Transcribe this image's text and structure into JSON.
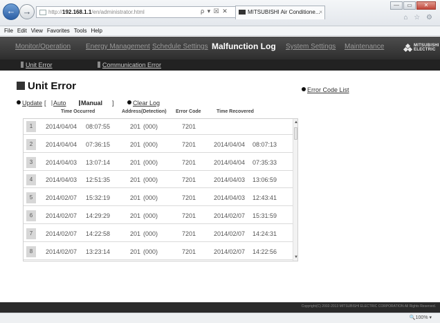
{
  "browser": {
    "address_prefix": "http://",
    "address_host": "192.168.1.1",
    "address_path": "/en/administrator.html",
    "address_tools": "ρ ▾ ☒ ✕",
    "tab_title": "MITSUBISHI Air Conditione...",
    "tab_close": "×",
    "back_glyph": "←",
    "forward_glyph": "→",
    "window_minimize": "—",
    "window_restore": "▭",
    "window_close": "✕",
    "toolbar_icons": "⌂ ☆ ⚙",
    "menu": [
      "File",
      "Edit",
      "View",
      "Favorites",
      "Tools",
      "Help"
    ],
    "zoom": "🔍100%  ▾"
  },
  "nav": {
    "items": [
      "Monitor/Operation",
      "Energy Management",
      "Schedule Settings",
      "Malfunction Log",
      "System Settings",
      "Maintenance"
    ],
    "active": "Malfunction Log",
    "logo_line1": "MITSUBISHI",
    "logo_line2": "ELECTRIC"
  },
  "subnav": {
    "items": [
      "Unit Error",
      "Communication Error"
    ]
  },
  "page": {
    "title": "Unit Error",
    "error_code_list": "Error Code List",
    "update": "Update",
    "bracket_open": "[",
    "auto": "Auto",
    "manual": "Manual",
    "bracket_close": "]",
    "clear_log": "Clear Log"
  },
  "table": {
    "headers": [
      "Time Occurred",
      "Address(Detection)",
      "Error Code",
      "Time Recovered"
    ],
    "rows": [
      {
        "num": "1",
        "date": "2014/04/04",
        "time": "08:07:55",
        "address": "201",
        "detection": "(000)",
        "code": "7201",
        "rec_date": "",
        "rec_time": ""
      },
      {
        "num": "2",
        "date": "2014/04/04",
        "time": "07:36:15",
        "address": "201",
        "detection": "(000)",
        "code": "7201",
        "rec_date": "2014/04/04",
        "rec_time": "08:07:13"
      },
      {
        "num": "3",
        "date": "2014/04/03",
        "time": "13:07:14",
        "address": "201",
        "detection": "(000)",
        "code": "7201",
        "rec_date": "2014/04/04",
        "rec_time": "07:35:33"
      },
      {
        "num": "4",
        "date": "2014/04/03",
        "time": "12:51:35",
        "address": "201",
        "detection": "(000)",
        "code": "7201",
        "rec_date": "2014/04/03",
        "rec_time": "13:06:59"
      },
      {
        "num": "5",
        "date": "2014/02/07",
        "time": "15:32:19",
        "address": "201",
        "detection": "(000)",
        "code": "7201",
        "rec_date": "2014/04/03",
        "rec_time": "12:43:41"
      },
      {
        "num": "6",
        "date": "2014/02/07",
        "time": "14:29:29",
        "address": "201",
        "detection": "(000)",
        "code": "7201",
        "rec_date": "2014/02/07",
        "rec_time": "15:31:59"
      },
      {
        "num": "7",
        "date": "2014/02/07",
        "time": "14:22:58",
        "address": "201",
        "detection": "(000)",
        "code": "7201",
        "rec_date": "2014/02/07",
        "rec_time": "14:24:31"
      },
      {
        "num": "8",
        "date": "2014/02/07",
        "time": "13:23:14",
        "address": "201",
        "detection": "(000)",
        "code": "7201",
        "rec_date": "2014/02/07",
        "rec_time": "14:22:56"
      }
    ]
  },
  "footer": {
    "copyright": "Copyright(C) 2002-2013 MITSUBISHI ELECTRIC CORPORATION All Rights Reserved."
  }
}
